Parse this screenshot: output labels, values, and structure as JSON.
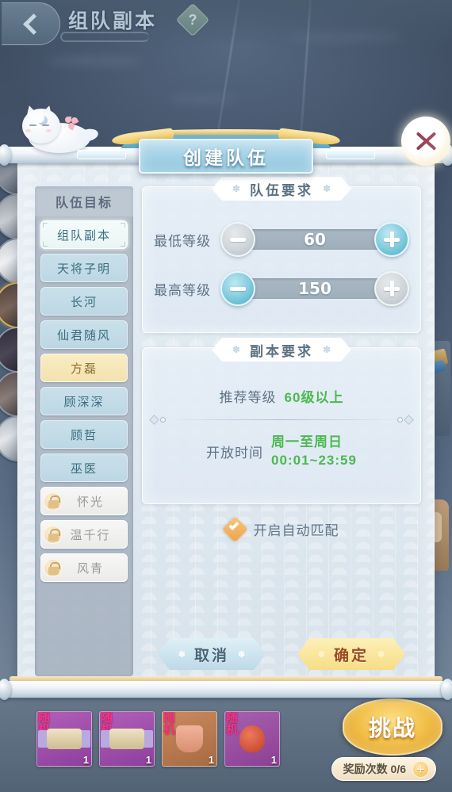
{
  "topbar": {
    "back_icon": "back-chevron-icon",
    "title": "组队副本",
    "help_label": "?"
  },
  "modal": {
    "title": "创建队伍",
    "close_icon": "close-x-icon",
    "mascot": "cat-mascot-icon"
  },
  "sidebar": {
    "title": "队伍目标",
    "items": [
      {
        "label": "组队副本",
        "state": "active",
        "locked": false
      },
      {
        "label": "天将子明",
        "state": "normal",
        "locked": false
      },
      {
        "label": "长河",
        "state": "normal",
        "locked": false
      },
      {
        "label": "仙君随风",
        "state": "normal",
        "locked": false
      },
      {
        "label": "方磊",
        "state": "gold",
        "locked": false
      },
      {
        "label": "顾深深",
        "state": "normal",
        "locked": false
      },
      {
        "label": "顾哲",
        "state": "normal",
        "locked": false
      },
      {
        "label": "巫医",
        "state": "normal",
        "locked": false
      },
      {
        "label": "怀光",
        "state": "locked",
        "locked": true
      },
      {
        "label": "温千行",
        "state": "locked",
        "locked": true
      },
      {
        "label": "风青",
        "state": "locked",
        "locked": true
      }
    ],
    "lock_icon": "lock-icon"
  },
  "team_panel": {
    "title": "队伍要求",
    "star": "✽",
    "rows": [
      {
        "label": "最低等级",
        "value": "60",
        "minus_enabled": false,
        "plus_enabled": true,
        "minus_icon": "minus-icon",
        "plus_icon": "plus-icon"
      },
      {
        "label": "最高等级",
        "value": "150",
        "minus_enabled": true,
        "plus_enabled": false,
        "minus_icon": "minus-icon",
        "plus_icon": "plus-icon"
      }
    ]
  },
  "dungeon_panel": {
    "title": "副本要求",
    "star": "✽",
    "recommend_label": "推荐等级",
    "recommend_value": "60级以上",
    "time_label": "开放时间",
    "time_value_line1": "周一至周日",
    "time_value_line2": "00:01~23:59"
  },
  "auto_match": {
    "label": "开启自动匹配",
    "checked": true,
    "check_icon": "checkmark-icon"
  },
  "actions": {
    "cancel_label": "取消",
    "confirm_label": "确定",
    "star": "✽"
  },
  "bottom_hud": {
    "rewards": [
      {
        "tag": "随机",
        "count": "1",
        "icon": "scroll-item-icon"
      },
      {
        "tag": "随机",
        "count": "1",
        "icon": "scroll-item-icon"
      },
      {
        "tag": "随机",
        "count": "1",
        "icon": "pouch-item-icon"
      },
      {
        "tag": "随机",
        "count": "1",
        "icon": "amulet-item-icon"
      }
    ],
    "challenge_label": "挑战",
    "reward_count_label": "奖励次数 0/6",
    "reward_plus_icon": "plus-icon"
  },
  "colors": {
    "green_value": "#4cb950",
    "gold_confirm": "#f6dd86",
    "accent_cyan": "#7fcadd",
    "paper": "#e3ecf3",
    "sidebar": "#b0bac7"
  }
}
